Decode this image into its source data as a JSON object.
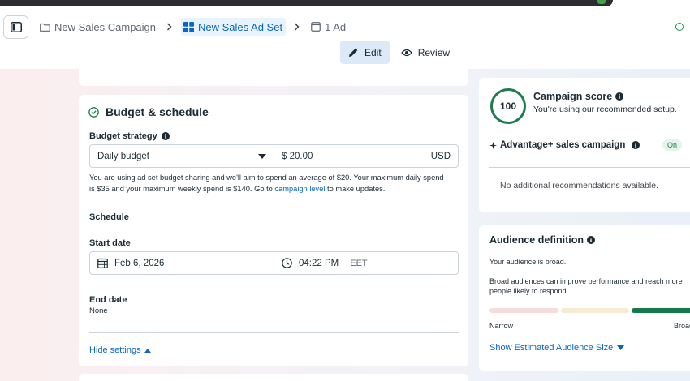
{
  "breadcrumb": {
    "campaign": "New Sales Campaign",
    "ad_set": "New Sales Ad Set",
    "ad": "1 Ad"
  },
  "modes": {
    "edit": "Edit",
    "review": "Review"
  },
  "budget_schedule": {
    "title": "Budget & schedule",
    "strategy_label": "Budget strategy",
    "strategy_value": "Daily budget",
    "amount": "$ 20.00",
    "currency": "USD",
    "helper_text": "You are using ad set budget sharing and we'll aim to spend an average of $20. Your maximum daily spend is $35 and your maximum weekly spend is $140. Go to",
    "helper_link": "campaign level",
    "helper_tail": "to make updates.",
    "schedule_label": "Schedule",
    "start_label": "Start date",
    "start_date": "Feb 6, 2026",
    "start_time": "04:22 PM",
    "timezone": "EET",
    "end_label": "End date",
    "end_value": "None",
    "hide_settings": "Hide settings"
  },
  "campaign_score": {
    "score": "100",
    "title": "Campaign score",
    "subtitle": "You're using our recommended setup.",
    "advantage_label": "Advantage+ sales campaign",
    "advantage_status": "On",
    "no_recommendations": "No additional recommendations available."
  },
  "audience": {
    "title": "Audience definition",
    "status": "Your audience is broad.",
    "description": "Broad audiences can improve performance and reach more people likely to respond.",
    "narrow_label": "Narrow",
    "broad_label": "Broad",
    "show_size_link": "Show Estimated Audience Size"
  },
  "colors": {
    "accent": "#0a66c2",
    "score_green": "#1e7d4e"
  }
}
